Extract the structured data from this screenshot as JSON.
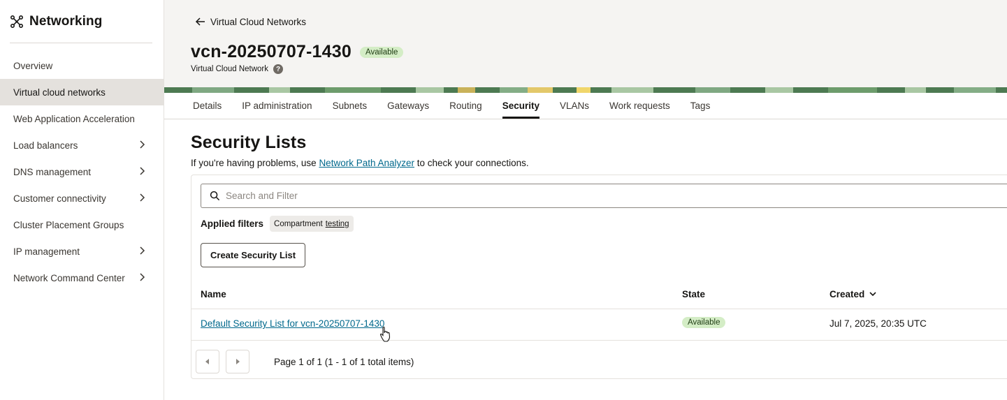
{
  "sidebar": {
    "title": "Networking",
    "items": [
      {
        "label": "Overview"
      },
      {
        "label": "Virtual cloud networks"
      },
      {
        "label": "Web Application Acceleration"
      },
      {
        "label": "Load balancers"
      },
      {
        "label": "DNS management"
      },
      {
        "label": "Customer connectivity"
      },
      {
        "label": "Cluster Placement Groups"
      },
      {
        "label": "IP management"
      },
      {
        "label": "Network Command Center"
      }
    ]
  },
  "header": {
    "back_label": "Virtual Cloud Networks",
    "title": "vcn-20250707-1430",
    "status": "Available",
    "subtitle": "Virtual Cloud Network",
    "help": "?"
  },
  "tabs": [
    {
      "label": "Details"
    },
    {
      "label": "IP administration"
    },
    {
      "label": "Subnets"
    },
    {
      "label": "Gateways"
    },
    {
      "label": "Routing"
    },
    {
      "label": "Security"
    },
    {
      "label": "VLANs"
    },
    {
      "label": "Work requests"
    },
    {
      "label": "Tags"
    }
  ],
  "section": {
    "title": "Security Lists",
    "help_prefix": "If you're having problems, use ",
    "help_link": "Network Path Analyzer",
    "help_suffix": " to check your connections."
  },
  "search": {
    "placeholder": "Search and Filter"
  },
  "filters": {
    "label": "Applied filters",
    "chip_key": "Compartment",
    "chip_value": "testing"
  },
  "create_button": "Create Security List",
  "table": {
    "columns": {
      "name": "Name",
      "state": "State",
      "created": "Created"
    },
    "rows": [
      {
        "name": "Default Security List for vcn-20250707-1430",
        "state": "Available",
        "created": "Jul 7, 2025, 20:35 UTC"
      }
    ]
  },
  "pagination": {
    "text": "Page 1 of 1 (1 - 1 of 1 total items)"
  }
}
